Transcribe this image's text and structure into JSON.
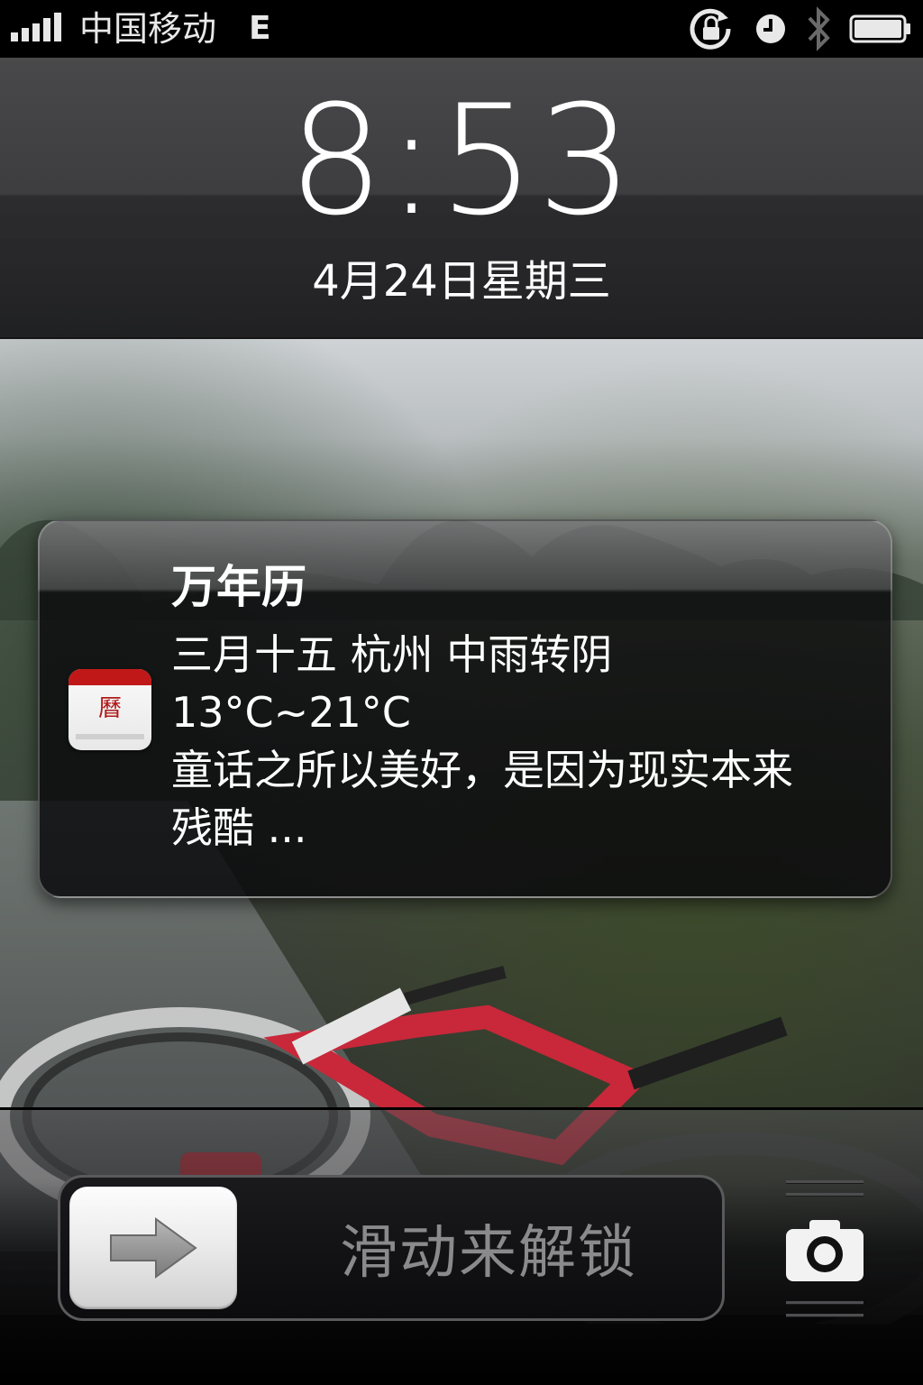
{
  "status_bar": {
    "carrier": "中国移动",
    "network": "E",
    "icons": [
      "signal-icon",
      "orientation-lock-icon",
      "alarm-icon",
      "bluetooth-icon",
      "battery-icon"
    ]
  },
  "lock_screen": {
    "time": "8:53",
    "date": "4月24日星期三"
  },
  "notification": {
    "app_icon": "calendar-app-icon",
    "app_name": "万年历",
    "lines": [
      "三月十五 杭州  中雨转阴",
      "13°C~21°C",
      "童话之所以美好，是因为现实本来",
      "残酷 ..."
    ]
  },
  "unlock": {
    "label": "滑动来解锁",
    "knob_icon": "arrow-right-icon",
    "camera_icon": "camera-icon"
  }
}
